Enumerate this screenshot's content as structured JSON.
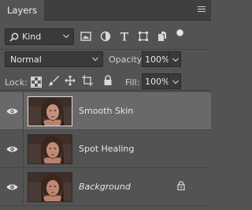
{
  "header": {
    "tab_label": "Layers"
  },
  "filter": {
    "kind_label": "Kind"
  },
  "blend": {
    "mode": "Normal",
    "opacity_label": "Opacity:",
    "opacity_value": "100%"
  },
  "lock": {
    "label": "Lock:",
    "fill_label": "Fill:",
    "fill_value": "100%"
  },
  "layers": [
    {
      "name": "Smooth Skin",
      "selected": true
    },
    {
      "name": "Spot Healing",
      "selected": false
    },
    {
      "name": "Background",
      "selected": false,
      "locked": true
    }
  ],
  "icons": {
    "filter": [
      "image-filter-icon",
      "adjustment-filter-icon",
      "type-filter-icon",
      "shape-filter-icon",
      "smart-object-filter-icon"
    ],
    "lock": [
      "lock-transparent-pixels-icon",
      "lock-image-pixels-icon",
      "lock-position-icon",
      "lock-artboard-icon",
      "lock-all-icon"
    ]
  },
  "colors": {
    "panel_bg": "#535353",
    "header_bg": "#3f3f3f",
    "selected_row": "#696969",
    "field_bg": "#3a3a3a"
  }
}
